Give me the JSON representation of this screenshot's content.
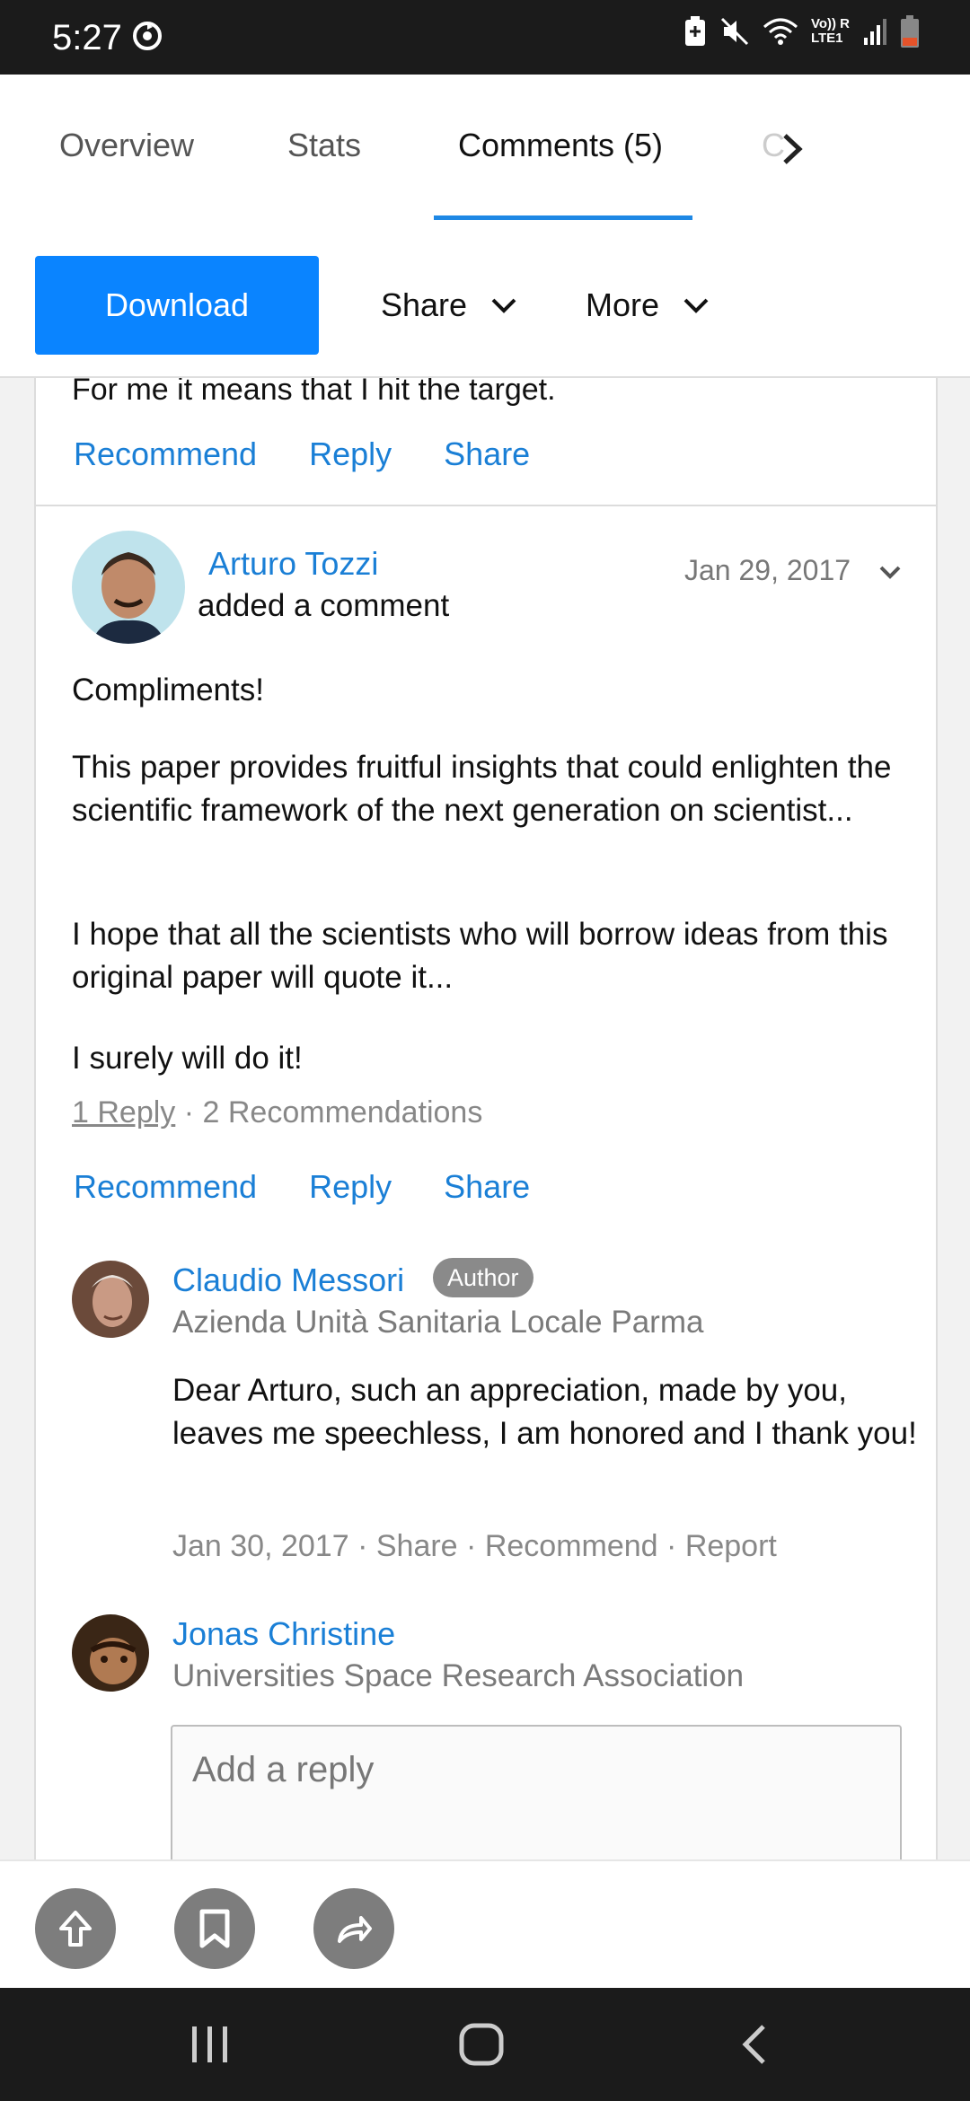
{
  "status_bar": {
    "time": "5:27",
    "icons": [
      "sync-icon",
      "battery-saver-icon",
      "mute-icon",
      "wifi-icon",
      "volte-icon",
      "signal-icon",
      "battery-icon"
    ],
    "volte_label": "Vo)) R",
    "lte_label": "LTE1"
  },
  "tabs": {
    "items": [
      {
        "label": "Overview"
      },
      {
        "label": "Stats"
      },
      {
        "label": "Comments (5)"
      }
    ],
    "active_index": 2,
    "partial_next_label": "C"
  },
  "toolbar": {
    "download_label": "Download",
    "share_label": "Share",
    "more_label": "More"
  },
  "previous_comment": {
    "text_tail": "For me it means that I hit the target.",
    "actions": {
      "recommend": "Recommend",
      "reply": "Reply",
      "share": "Share"
    }
  },
  "comment": {
    "author": "Arturo Tozzi",
    "action_text": "added a comment",
    "date": "Jan 29, 2017",
    "paragraphs": [
      "Compliments!",
      "This paper provides fruitful insights that could enlighten the scientific framework of the next generation on scientist...",
      "I hope that all the scientists who will borrow ideas from this original paper will quote it...",
      "I surely will do it!"
    ],
    "reply_count_label": "1 Reply",
    "recommendations_label": "2 Recommendations",
    "actions": {
      "recommend": "Recommend",
      "reply": "Reply",
      "share": "Share"
    }
  },
  "reply": {
    "author": "Claudio Messori",
    "badge": "Author",
    "org": "Azienda Unità Sanitaria Locale Parma",
    "text": "Dear Arturo, such an appreciation, made by you, leaves me speechless, I am honored and I thank you!",
    "date": "Jan 30, 2017",
    "share": "Share",
    "recommend": "Recommend",
    "report": "Report"
  },
  "current_user": {
    "name": "Jonas Christine",
    "org": "Universities Space Research Association",
    "reply_placeholder": "Add a reply"
  },
  "bottom_actions": [
    "scroll-up-icon",
    "bookmark-icon",
    "share-forward-icon"
  ],
  "nav_bar": [
    "recents-icon",
    "home-icon",
    "back-icon"
  ],
  "colors": {
    "accent": "#1a7fd6",
    "download_button": "#0a84ff",
    "tab_indicator": "#1e88e5",
    "badge": "#8a8a8a"
  }
}
